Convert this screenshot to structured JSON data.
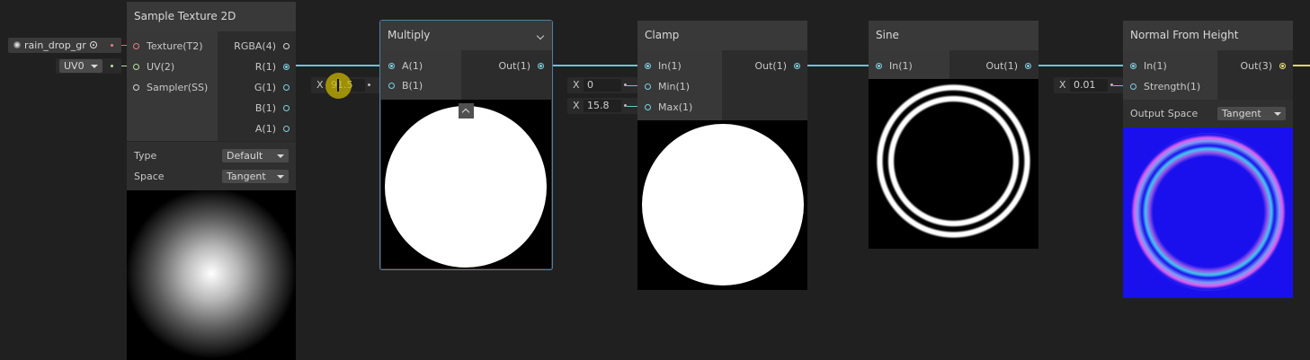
{
  "nodes": {
    "sample_texture": {
      "title": "Sample Texture 2D",
      "inputs": [
        "Texture(T2)",
        "UV(2)",
        "Sampler(SS)"
      ],
      "outputs": [
        "RGBA(4)",
        "R(1)",
        "G(1)",
        "B(1)",
        "A(1)"
      ],
      "type_label": "Type",
      "type_value": "Default",
      "space_label": "Space",
      "space_value": "Tangent"
    },
    "multiply": {
      "title": "Multiply",
      "inputs": [
        "A(1)",
        "B(1)"
      ],
      "output": "Out(1)",
      "b_axis": "X",
      "b_value": "91.5"
    },
    "clamp": {
      "title": "Clamp",
      "inputs": [
        "In(1)",
        "Min(1)",
        "Max(1)"
      ],
      "output": "Out(1)",
      "min_axis": "X",
      "min_value": "0",
      "max_axis": "X",
      "max_value": "15.8"
    },
    "sine": {
      "title": "Sine",
      "input": "In(1)",
      "output": "Out(1)"
    },
    "normal_from_height": {
      "title": "Normal From Height",
      "inputs": [
        "In(1)",
        "Strength(1)"
      ],
      "output": "Out(3)",
      "strength_axis": "X",
      "strength_value": "0.01",
      "output_space_label": "Output Space",
      "output_space_value": "Tangent"
    }
  },
  "inline_inputs": {
    "texture_property": "rain_drop_gr",
    "uv_channel": "UV0"
  },
  "colors": {
    "float_wire": "#6cc3d2",
    "vector3_wire": "#ddd66a",
    "texture_wire": "#d87070",
    "cursor_highlight": "#c8b400"
  }
}
